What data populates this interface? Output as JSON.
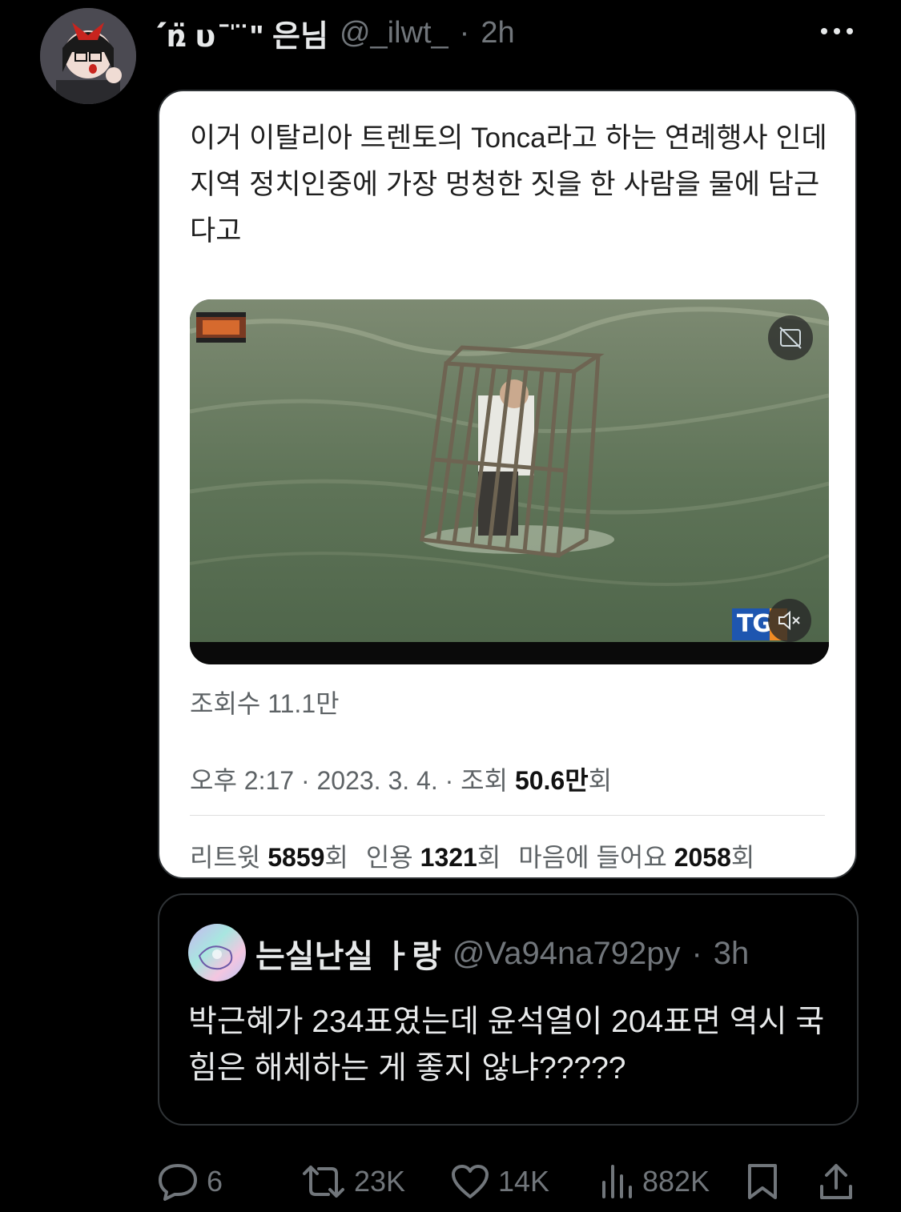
{
  "tweet": {
    "display_name": "՛ռ̈ 𝞄 ̄ ̍ ̈ \" 은님",
    "handle": "@_ilwt_",
    "time_sep": "·",
    "time": "2h"
  },
  "screenshot": {
    "text": "이거 이탈리아 트렌토의 Tonca라고 하는 연례행사 인데 지역 정치인중에 가장 멍청한 짓을 한 사람을 물에 담근다고",
    "video_views": "조회수 11.1만",
    "video_logo": "TG",
    "meta_prefix": "오후 2:17 · 2023. 3. 4. · 조회 ",
    "meta_views_bold": "50.6만",
    "meta_views_suffix": "회",
    "retweets_label": "리트윗 ",
    "retweets_value": "5859",
    "retweets_suffix": "회",
    "quotes_label": "인용 ",
    "quotes_value": "1321",
    "quotes_suffix": "회",
    "likes_label": "마음에 들어요 ",
    "likes_value": "2058",
    "likes_suffix": "회"
  },
  "quote": {
    "display_name": "는실난실 ㅏ랑",
    "handle": "@Va94na792py",
    "time_sep": "·",
    "time": "3h",
    "text": "박근혜가 234표였는데 윤석열이 204표면 역시 국힘은 해체하는 게 좋지 않냐?????"
  },
  "actions": {
    "replies": "6",
    "reposts": "23K",
    "likes": "14K",
    "views": "882K"
  },
  "icons": [
    "more-icon",
    "reply-icon",
    "repost-icon",
    "like-icon",
    "views-icon",
    "bookmark-icon",
    "share-icon",
    "gif-icon",
    "mute-icon"
  ]
}
